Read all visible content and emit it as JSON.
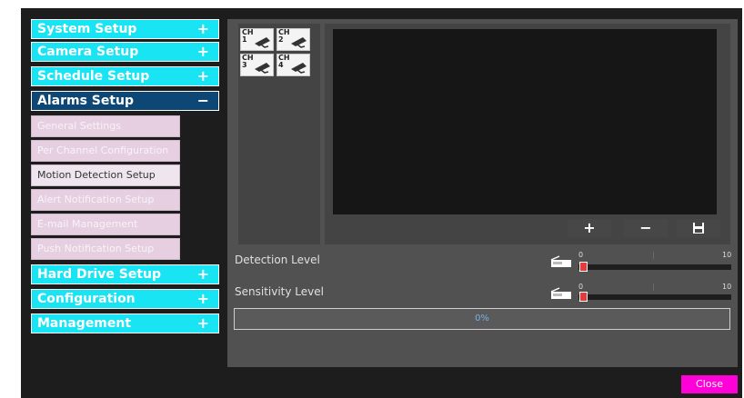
{
  "sidebar": {
    "categories": [
      {
        "label": "System Setup",
        "sign": "+"
      },
      {
        "label": "Camera Setup",
        "sign": "+"
      },
      {
        "label": "Schedule Setup",
        "sign": "+"
      },
      {
        "label": "Alarms Setup",
        "sign": "−"
      },
      {
        "label": "Hard Drive Setup",
        "sign": "+"
      },
      {
        "label": "Configuration",
        "sign": "+"
      },
      {
        "label": "Management",
        "sign": "+"
      }
    ],
    "alarm_subitems": [
      {
        "label": "General Settings"
      },
      {
        "label": "Per Channel Configuration"
      },
      {
        "label": "Motion Detection Setup"
      },
      {
        "label": "Alert Notification Setup"
      },
      {
        "label": "E-mail Management"
      },
      {
        "label": "Push Notification Setup"
      }
    ]
  },
  "channels": [
    {
      "prefix": "CH",
      "num": "1"
    },
    {
      "prefix": "CH",
      "num": "2"
    },
    {
      "prefix": "CH",
      "num": "3"
    },
    {
      "prefix": "CH",
      "num": "4"
    }
  ],
  "video_controls": {
    "add": "+",
    "remove": "−",
    "save": "save-icon"
  },
  "levels": [
    {
      "label": "Detection Level",
      "min": "0",
      "max": "10",
      "value": 0
    },
    {
      "label": "Sensitivity Level",
      "min": "0",
      "max": "10",
      "value": 0
    }
  ],
  "progress": {
    "text": "0%",
    "value": 0
  },
  "close_label": "Close",
  "colors": {
    "category_bg": "#18e4f4",
    "active_category_bg": "#0d4775",
    "subitem_bg": "#e6cfe0",
    "slider_knob": "#e73b3b",
    "close_button": "#ff00d8",
    "progress_text": "#79aee8"
  }
}
